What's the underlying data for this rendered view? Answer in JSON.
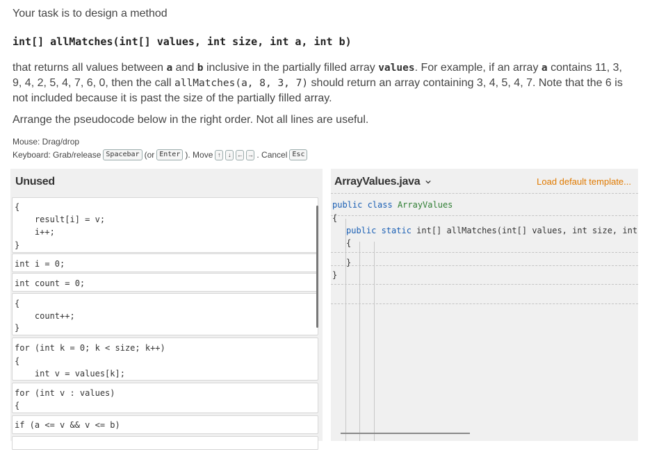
{
  "intro": "Your task is to design a method",
  "signature": "int[] allMatches(int[] values, int size, int a, int b)",
  "description": {
    "t1": "that returns all values between ",
    "c1": "a",
    "t2": " and ",
    "c2": "b",
    "t3": " inclusive in the partially filled array ",
    "c3": "values",
    "t4": ". For example, if an array ",
    "c4": "a",
    "t5": " contains 11, 3, 9, 4, 2, 5, 4, 7, 6, 0, then the call ",
    "c5": "allMatches(a, 8, 3, 7)",
    "t6": " should return an array containing 3, 4, 5, 4, 7. Note that the 6 is not included because it is past the size of the partially filled array."
  },
  "arrange": "Arrange the pseudocode below in the right order. Not all lines are useful.",
  "hints": {
    "mouse": "Mouse: Drag/drop",
    "keyboard_prefix": "Keyboard: Grab/release",
    "spacebar": "Spacebar",
    "or_open": "(or",
    "enter": "Enter",
    "move": "). Move",
    "up": "↑",
    "down": "↓",
    "left": "←",
    "right": "→",
    "cancel": ". Cancel",
    "esc": "Esc"
  },
  "unused": {
    "title": "Unused",
    "blocks": [
      {
        "lines": [
          "{",
          "    result[i] = v;",
          "    i++;",
          "}"
        ]
      },
      {
        "lines": [
          "int i = 0;"
        ]
      },
      {
        "lines": [
          "int count = 0;"
        ]
      },
      {
        "lines": [
          "{",
          "    count++;",
          "}"
        ]
      },
      {
        "lines": [
          "for (int k = 0; k < size; k++)",
          "{",
          "    int v = values[k];"
        ]
      },
      {
        "lines": [
          "for (int v : values)",
          "{"
        ]
      },
      {
        "lines": [
          "if (a <= v && v <= b)"
        ]
      }
    ]
  },
  "editor": {
    "filename": "ArrayValues.java",
    "load_template": "Load default template...",
    "code": {
      "l1_kw": "public class",
      "l1_name": "ArrayValues",
      "l2": "{",
      "l3_kw": "public static",
      "l3_rest": "int[] allMatches(int[] values, int size, int a",
      "l4": "{",
      "l5": "}",
      "l6": "}"
    }
  },
  "colors": {
    "accent_link": "#e07a00",
    "keyword": "#1a5fb4",
    "class_name": "#2e7d32",
    "panel_bg": "#f0f0f0"
  }
}
